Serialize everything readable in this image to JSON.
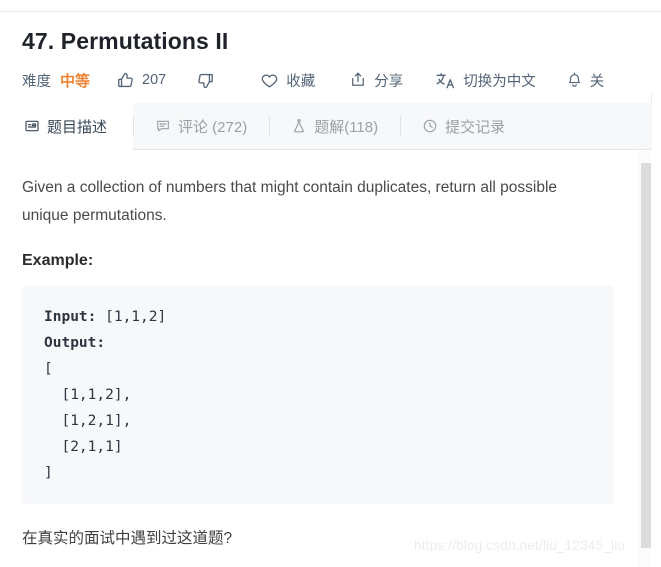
{
  "page": {
    "title": "47. Permutations II"
  },
  "meta": {
    "difficulty_label": "难度",
    "difficulty_value": "中等",
    "difficulty_color": "#ef8432",
    "upvote_icon": "thumbs-up-icon",
    "upvote_count": "207",
    "downvote_icon": "thumbs-down-icon",
    "downvote_count": "",
    "favorite_icon": "heart-icon",
    "favorite_label": "收藏",
    "share_icon": "share-icon",
    "share_label": "分享",
    "translate_icon": "translate-icon",
    "translate_label": "切换为中文",
    "notify_icon": "bell-icon",
    "notify_label": "关注"
  },
  "tabs": [
    {
      "id": "description",
      "icon": "description-icon",
      "label": "题目描述",
      "active": true
    },
    {
      "id": "comments",
      "icon": "comment-icon",
      "label": "评论 (272)",
      "active": false
    },
    {
      "id": "solutions",
      "icon": "flask-icon",
      "label": "题解(118)",
      "active": false
    },
    {
      "id": "submissions",
      "icon": "clock-icon",
      "label": "提交记录",
      "active": false
    }
  ],
  "content": {
    "description": "Given a collection of numbers that might contain duplicates, return all possible unique permutations.",
    "example_heading": "Example:",
    "code_input_label": "Input:",
    "code_input_value": " [1,1,2]",
    "code_output_label": "Output:",
    "code_output_value": "\n[\n  [1,1,2],\n  [1,2,1],\n  [2,1,1]\n]",
    "bottom_question": "在真实的面试中遇到过这道题?"
  },
  "watermark": {
    "text": "https://blog.csdn.net/liu_12345_liu"
  },
  "colors": {
    "accent_orange": "#ef8432",
    "text_slate": "#546579",
    "tab_active": "#394756",
    "tab_inactive": "#9aa0a6",
    "code_bg": "#f7f8fa",
    "tabstrip_bg": "#f7f8f9"
  }
}
